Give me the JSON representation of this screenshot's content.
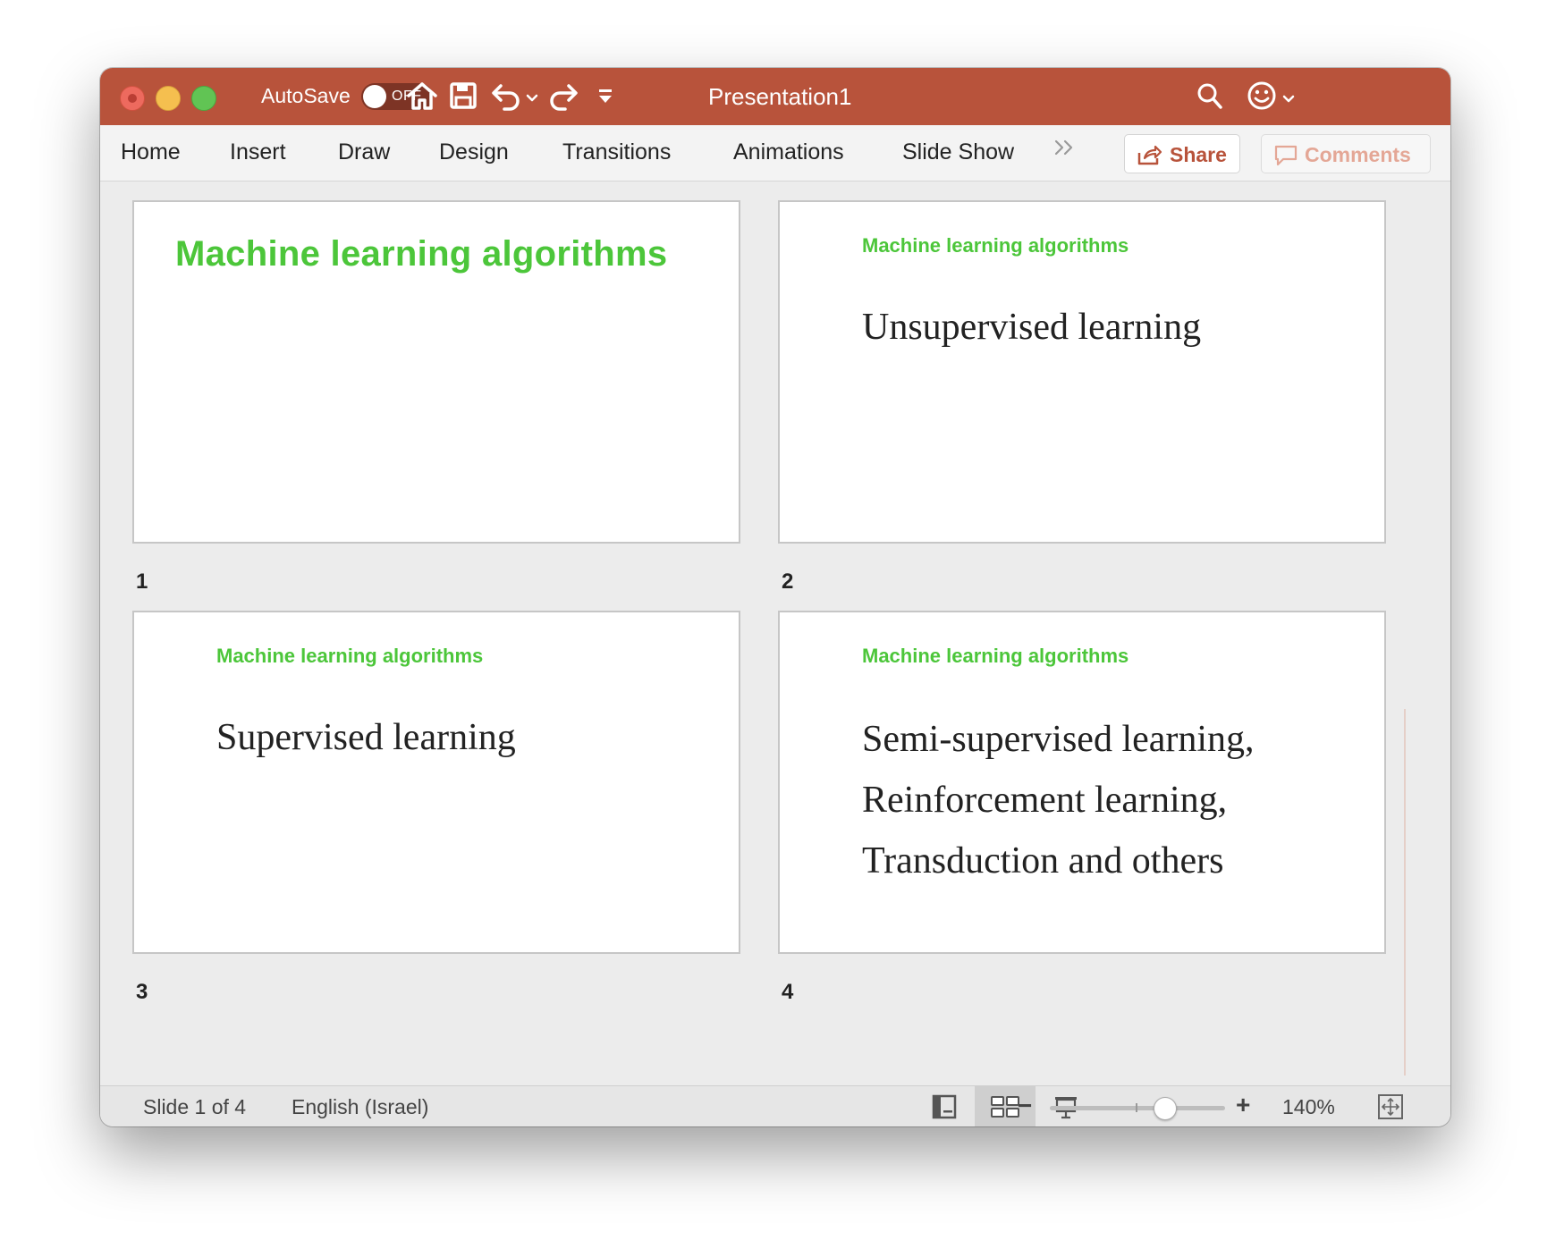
{
  "titlebar": {
    "autosave_label": "AutoSave",
    "autosave_state": "OFF",
    "document_title": "Presentation1",
    "accent_color": "#b8533b"
  },
  "ribbon": {
    "tabs": [
      "Home",
      "Insert",
      "Draw",
      "Design",
      "Transitions",
      "Animations",
      "Slide Show"
    ],
    "share_label": "Share",
    "comments_label": "Comments"
  },
  "slides": [
    {
      "number": "1",
      "title": "Machine learning algorithms",
      "body": []
    },
    {
      "number": "2",
      "title": "Machine learning algorithms",
      "body": [
        "Unsupervised learning"
      ]
    },
    {
      "number": "3",
      "title": "Machine learning algorithms",
      "body": [
        "Supervised learning"
      ]
    },
    {
      "number": "4",
      "title": "Machine learning algorithms",
      "body": [
        "Semi-supervised learning,",
        "Reinforcement learning,",
        "Transduction and others"
      ]
    }
  ],
  "statusbar": {
    "slide_position": "Slide 1 of 4",
    "language": "English (Israel)",
    "zoom": "140%"
  },
  "colors": {
    "slide_title_green": "#4cc63a"
  },
  "icons": [
    "home-icon",
    "save-icon",
    "undo-icon",
    "redo-icon",
    "customize-toolbar-icon",
    "search-icon",
    "feedback-smiley-icon",
    "share-icon",
    "comment-icon",
    "normal-view-icon",
    "slide-sorter-icon",
    "presenter-view-icon",
    "fit-to-window-icon"
  ]
}
